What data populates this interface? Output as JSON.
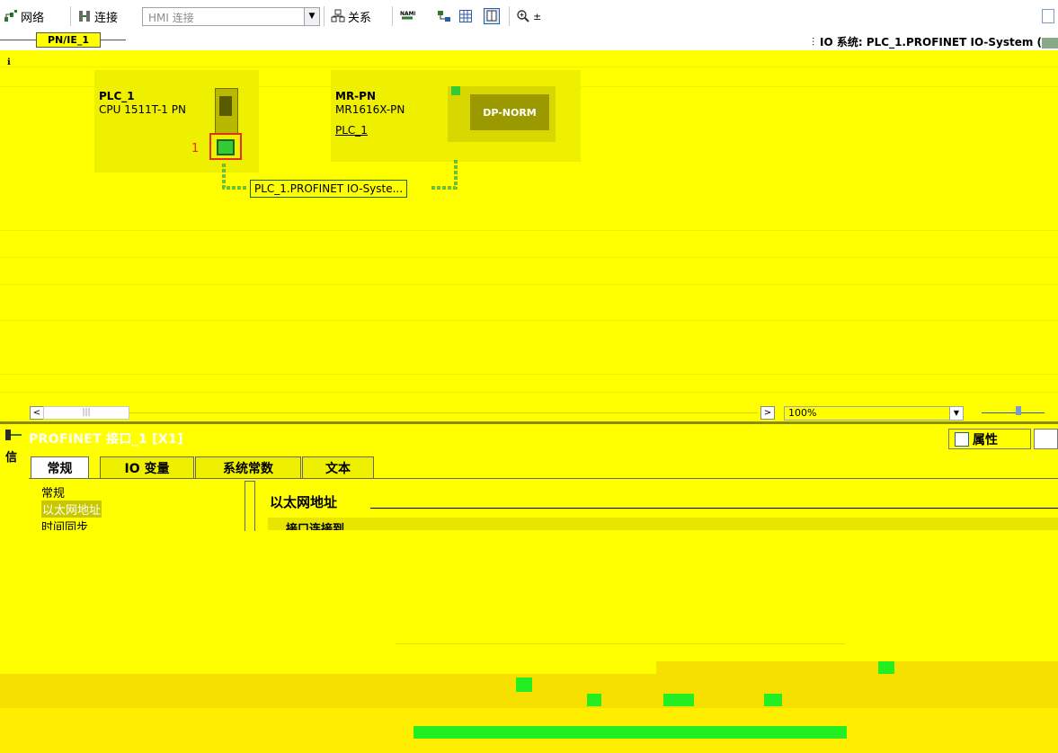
{
  "toolbar": {
    "network_label": "网络",
    "connections_label": "连接",
    "connection_type_value": "HMI 连接",
    "relations_label": "关系"
  },
  "subnet": {
    "name": "PN/IE_1"
  },
  "io_system_title": "IO 系统: PLC_1.PROFINET IO-System (",
  "devices": {
    "plc": {
      "name": "PLC_1",
      "type": "CPU 1511T-1 PN",
      "marker": "1"
    },
    "io_device": {
      "name": "MR-PN",
      "type": "MR1616X-PN",
      "assigned_controller": "PLC_1",
      "module_label": "DP-NORM"
    }
  },
  "io_system_link_label": "PLC_1.PROFINET IO-Syste...",
  "zoom": {
    "value": "100%"
  },
  "properties": {
    "title": "PROFINET 接口_1 [X1]",
    "properties_tab": "属性",
    "tabs": [
      "常规",
      "IO 变量",
      "系统常数",
      "文本"
    ],
    "nav_items": [
      "常规",
      "以太网地址",
      "时间同步"
    ],
    "section_title": "以太网地址",
    "subsection_title": "接口连接到"
  },
  "colors": {
    "background": "#ffff00",
    "selection_text": "#ffffff",
    "device_fill": "#efef00",
    "link_green": "#33cc33"
  }
}
